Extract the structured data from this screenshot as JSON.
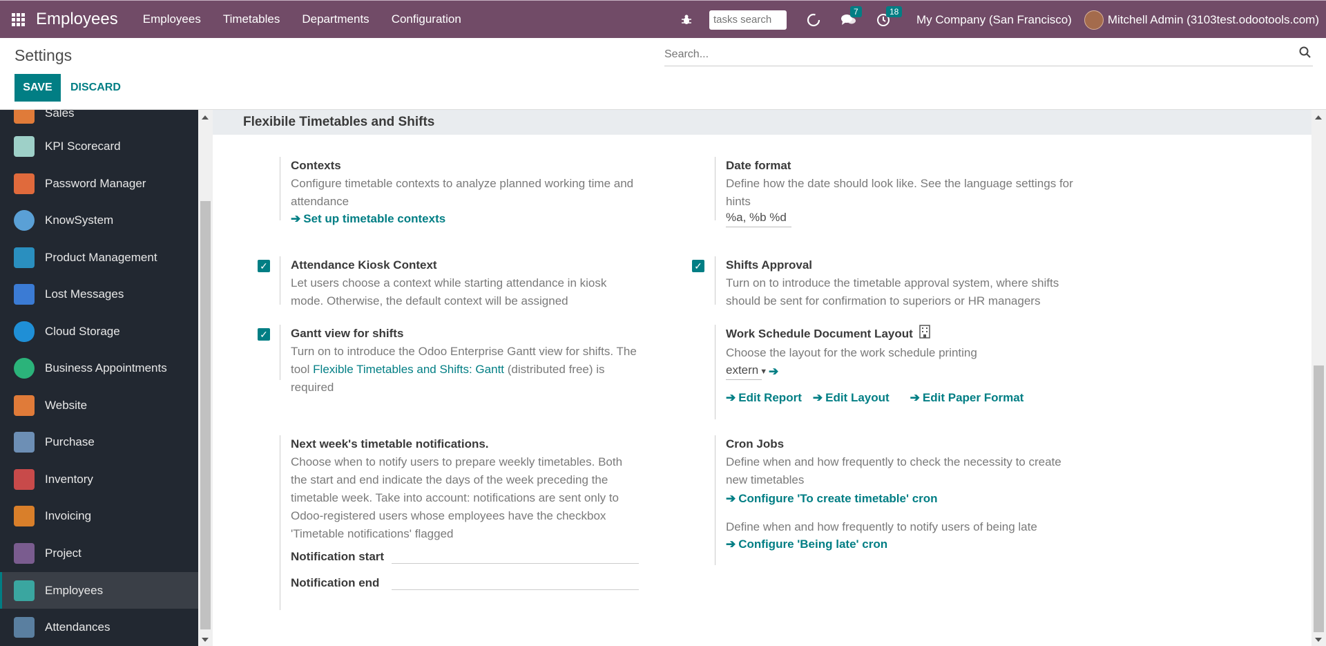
{
  "navbar": {
    "brand": "Employees",
    "menu": [
      "Employees",
      "Timetables",
      "Departments",
      "Configuration"
    ],
    "tasks_search_placeholder": "tasks search",
    "messages_count": "7",
    "activities_count": "18",
    "company": "My Company (San Francisco)",
    "user": "Mitchell Admin (3103test.odootools.com)"
  },
  "control": {
    "breadcrumb": "Settings",
    "save_label": "SAVE",
    "discard_label": "DISCARD",
    "search_placeholder": "Search..."
  },
  "sidebar": {
    "items": [
      {
        "label": "Sales",
        "icon": "sales-icon",
        "color": "#e07b39"
      },
      {
        "label": "KPI Scorecard",
        "icon": "kpi-icon",
        "color": "#9ed0c8"
      },
      {
        "label": "Password Manager",
        "icon": "password-icon",
        "color": "#e06a3c"
      },
      {
        "label": "KnowSystem",
        "icon": "knowsystem-icon",
        "color": "#5aa0d6"
      },
      {
        "label": "Product Management",
        "icon": "product-icon",
        "color": "#2a8fbf"
      },
      {
        "label": "Lost Messages",
        "icon": "lost-messages-icon",
        "color": "#3b7bd4"
      },
      {
        "label": "Cloud Storage",
        "icon": "cloud-icon",
        "color": "#1f8fd6"
      },
      {
        "label": "Business Appointments",
        "icon": "appointments-icon",
        "color": "#2bb37a"
      },
      {
        "label": "Website",
        "icon": "website-icon",
        "color": "#e07b39"
      },
      {
        "label": "Purchase",
        "icon": "purchase-icon",
        "color": "#6d8fb5"
      },
      {
        "label": "Inventory",
        "icon": "inventory-icon",
        "color": "#c84a4a"
      },
      {
        "label": "Invoicing",
        "icon": "invoicing-icon",
        "color": "#d97f2a"
      },
      {
        "label": "Project",
        "icon": "project-icon",
        "color": "#7a5c8f"
      },
      {
        "label": "Employees",
        "icon": "employees-icon",
        "color": "#3aa6a0"
      },
      {
        "label": "Attendances",
        "icon": "attendances-icon",
        "color": "#5a7fa0"
      }
    ]
  },
  "section": {
    "title": "Flexibile Timetables and Shifts"
  },
  "settings": {
    "contexts": {
      "title": "Contexts",
      "desc": "Configure timetable contexts to analyze planned working time and attendance",
      "link": "Set up timetable contexts"
    },
    "date_format": {
      "title": "Date format",
      "desc": "Define how the date should look like. See the language settings for hints",
      "value": "%a, %b %d"
    },
    "kiosk": {
      "title": "Attendance Kiosk Context",
      "desc": "Let users choose a context while starting attendance in kiosk mode. Otherwise, the default context will be assigned"
    },
    "shifts_approval": {
      "title": "Shifts Approval",
      "desc": "Turn on to introduce the timetable approval system, where shifts should be sent for confirmation to superiors or HR managers"
    },
    "gantt": {
      "title": "Gantt view for shifts",
      "desc_before": "Turn on to introduce the Odoo Enterprise Gantt view for shifts. The tool",
      "desc_link": "Flexible Timetables and Shifts: Gantt",
      "desc_after": "(distributed free) is required"
    },
    "layout": {
      "title": "Work Schedule Document Layout",
      "desc": "Choose the layout for the work schedule printing",
      "value": "extern",
      "edit_report": "Edit Report",
      "edit_layout": "Edit Layout",
      "edit_paper": "Edit Paper Format"
    },
    "notifications": {
      "title": "Next week's timetable notifications.",
      "desc": "Choose when to notify users to prepare weekly timetables. Both the start and end indicate the days of the week preceding the timetable week. Take into account: notifications are sent only to Odoo-registered users whose employees have the checkbox 'Timetable notifications' flagged",
      "start_label": "Notification start",
      "end_label": "Notification end"
    },
    "cron": {
      "title": "Cron Jobs",
      "desc1": "Define when and how frequently to check the necessity to create new timetables",
      "link1": "Configure 'To create timetable' cron",
      "desc2": "Define when and how frequently to notify users of being late",
      "link2": "Configure 'Being late' cron"
    }
  },
  "colors": {
    "navbar": "#714b67",
    "accent": "#017e84",
    "sidebar": "#222831"
  }
}
